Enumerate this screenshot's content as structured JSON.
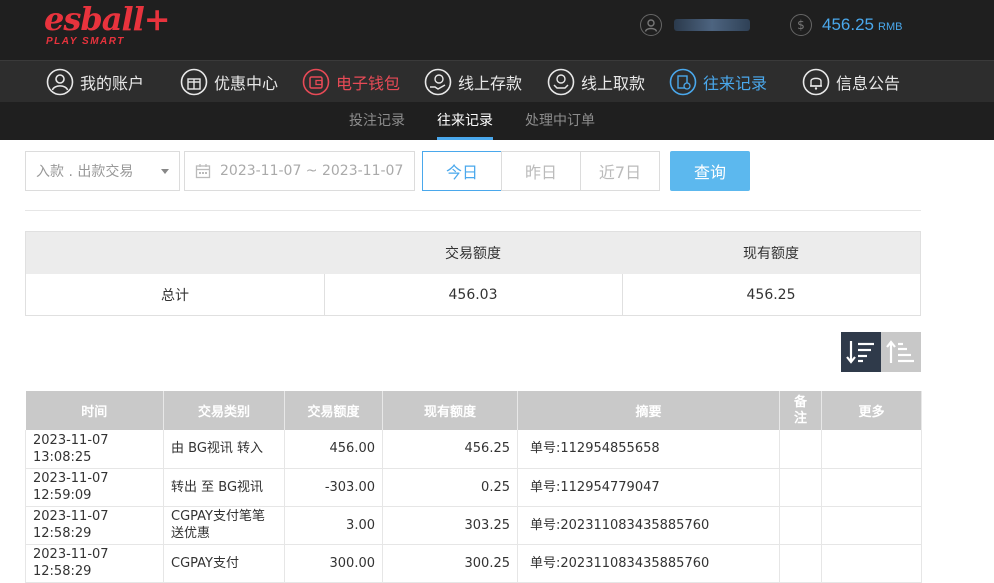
{
  "brand": {
    "logo_text": "esball+",
    "tagline": "PLAY SMART"
  },
  "account": {
    "balance": "456.25",
    "currency": "RMB"
  },
  "main_nav": [
    {
      "label": "我的账户",
      "icon": "user-icon"
    },
    {
      "label": "优惠中心",
      "icon": "gift-icon"
    },
    {
      "label": "电子钱包",
      "icon": "wallet-icon"
    },
    {
      "label": "线上存款",
      "icon": "deposit-icon"
    },
    {
      "label": "线上取款",
      "icon": "withdraw-icon"
    },
    {
      "label": "往来记录",
      "icon": "records-icon"
    },
    {
      "label": "信息公告",
      "icon": "bell-icon"
    }
  ],
  "sub_nav": [
    {
      "label": "投注记录"
    },
    {
      "label": "往来记录"
    },
    {
      "label": "处理中订单"
    }
  ],
  "filters": {
    "type_select": "入款 . 出款交易",
    "date_range": "2023-11-07 ~ 2023-11-07",
    "quick_ranges": [
      "今日",
      "昨日",
      "近7日"
    ],
    "active_range": "今日",
    "query_label": "查询"
  },
  "summary": {
    "headers": [
      "交易额度",
      "现有额度"
    ],
    "row_label": "总计",
    "transaction_total": "456.03",
    "current_balance": "456.25"
  },
  "table": {
    "columns": [
      "时间",
      "交易类别",
      "交易额度",
      "现有额度",
      "摘要",
      "备注",
      "更多"
    ],
    "rows": [
      {
        "time": "2023-11-07 13:08:25",
        "type": "由 BG视讯 转入",
        "amount": "456.00",
        "balance": "456.25",
        "memo": "单号:112954855658",
        "remark": "",
        "more": ""
      },
      {
        "time": "2023-11-07 12:59:09",
        "type": "转出 至 BG视讯",
        "amount": "-303.00",
        "balance": "0.25",
        "memo": "单号:112954779047",
        "remark": "",
        "more": ""
      },
      {
        "time": "2023-11-07 12:58:29",
        "type": "CGPAY支付笔笔送优惠",
        "amount": "3.00",
        "balance": "303.25",
        "memo": "单号:202311083435885760",
        "remark": "",
        "more": ""
      },
      {
        "time": "2023-11-07 12:58:29",
        "type": "CGPAY支付",
        "amount": "300.00",
        "balance": "300.25",
        "memo": "单号:202311083435885760",
        "remark": "",
        "more": ""
      }
    ]
  },
  "colors": {
    "accent_blue": "#4aa8ec",
    "accent_red": "#e74a56",
    "header_bg": "#1f1f1f"
  }
}
